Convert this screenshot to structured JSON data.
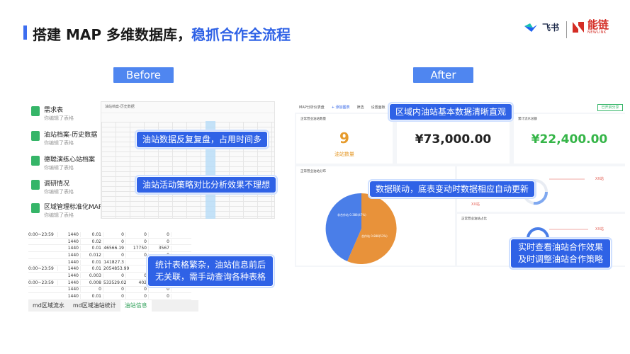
{
  "header": {
    "title_main": "搭建 MAP 多维数据库，",
    "title_highlight": "稳抓合作全流程",
    "logo_feishu": "飞书",
    "logo_newlink": "能链",
    "logo_newlink_sub": "NEWLINK"
  },
  "tags": {
    "before": "Before",
    "after": "After"
  },
  "before": {
    "docs": [
      {
        "name": "需求表",
        "sub": "你编辑了表格"
      },
      {
        "name": "油站档案-历史数据",
        "sub": "你编辑了表格"
      },
      {
        "name": "德聪演练心站档案",
        "sub": "你编辑了表格"
      },
      {
        "name": "调研情况",
        "sub": "你编辑了表格"
      },
      {
        "name": "区域管理标准化MAP",
        "sub": "你编辑了表格"
      }
    ],
    "sheet_title": "油站档案-历史数据",
    "callout1": "油站数据反复复盘，占用时间多",
    "callout2": "油站活动策略对比分析效果不理想",
    "callout3_line1": "统计表格繁杂，油站信息前后",
    "callout3_line2": "无关联，需手动查询各种表格",
    "table_rows": [
      [
        "0:00~23:59",
        "1440",
        "0.01",
        "0",
        "0",
        "0"
      ],
      [
        "",
        "1440",
        "0.02",
        "0",
        "0",
        "0"
      ],
      [
        "",
        "1440",
        "0.01",
        "46566.19",
        "17750",
        "3567"
      ],
      [
        "",
        "1440",
        "0.012",
        "0",
        "0",
        "0"
      ],
      [
        "",
        "1440",
        "0.01",
        "141827.3",
        "",
        ""
      ],
      [
        "0:00~23:59",
        "1440",
        "0.01",
        "2054853.99",
        "",
        ""
      ],
      [
        "",
        "1440",
        "0.003",
        "0",
        "0",
        "0"
      ],
      [
        "0:00~23:59",
        "1440",
        "0.008",
        "533529.02",
        "402",
        ""
      ],
      [
        "",
        "1440",
        "0",
        "0",
        "0",
        "0"
      ],
      [
        "",
        "1440",
        "0.01",
        "0",
        "0",
        "0"
      ]
    ],
    "tabs": [
      "md区域流水",
      "md区域油站统计",
      "油站信息"
    ]
  },
  "after": {
    "toolbar": [
      "MAP分析仪表盘",
      "+ 添加图表",
      "筛选",
      "设置面板"
    ],
    "share_label": "已开启分享",
    "callout1": "区域内油站基本数据清晰直观",
    "callout2": "数据联动，底表变动时数据相应自动更新",
    "callout3_line1": "实时查看油站合作效果",
    "callout3_line2": "及时调整油站合作策略",
    "card1_label": "正常营业油站数量",
    "station_count": "9",
    "station_count_label": "油站数量",
    "amount1": "¥73,000.00",
    "amount2": "¥22,400.00",
    "card3_label": "累计流水总额",
    "card4_label": "正常营业油站分布",
    "card5_label": "正常营业油站占比",
    "pie_label_a": "非合作站 0.388(47%)",
    "pie_label_b": "合作站 0.888(53%)",
    "xx_labels": [
      "XX站",
      "XX站",
      "XX站"
    ]
  },
  "colors": {
    "accent": "#2f62e6",
    "pie_blue": "#4a7ee8",
    "pie_orange": "#e8923a",
    "green_amount": "#35b548",
    "orange_num": "#e69b2c"
  }
}
